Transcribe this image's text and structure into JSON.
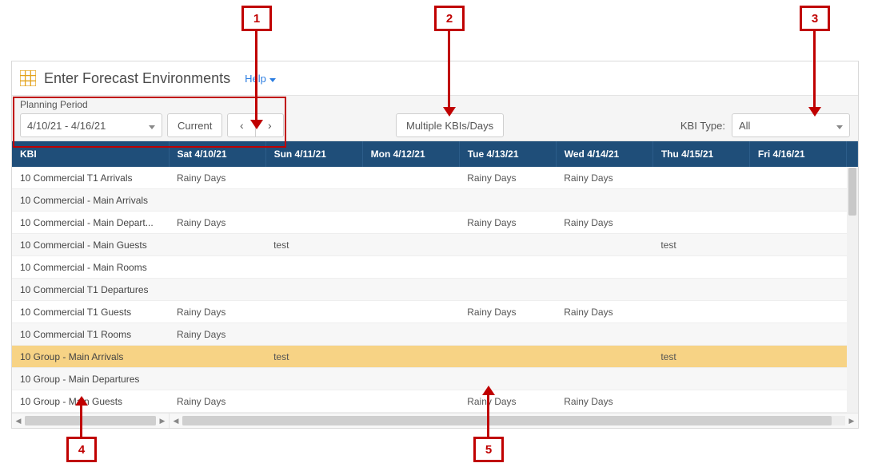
{
  "page_title": "Enter Forecast Environments",
  "help_label": "Help",
  "planning": {
    "label": "Planning Period",
    "range": "4/10/21 - 4/16/21",
    "current_label": "Current"
  },
  "multi_btn": "Multiple KBIs/Days",
  "kbi_type": {
    "label": "KBI Type:",
    "value": "All"
  },
  "columns": [
    "KBI",
    "Sat 4/10/21",
    "Sun 4/11/21",
    "Mon 4/12/21",
    "Tue 4/13/21",
    "Wed 4/14/21",
    "Thu 4/15/21",
    "Fri 4/16/21"
  ],
  "rows": [
    {
      "kbi": "10 Commercial T1 Arrivals",
      "cells": [
        "Rainy Days",
        "",
        "",
        "Rainy Days",
        "Rainy Days",
        "",
        ""
      ]
    },
    {
      "kbi": "10 Commercial - Main Arrivals",
      "cells": [
        "",
        "",
        "",
        "",
        "",
        "",
        ""
      ]
    },
    {
      "kbi": "10 Commercial - Main Depart...",
      "cells": [
        "Rainy Days",
        "",
        "",
        "Rainy Days",
        "Rainy Days",
        "",
        ""
      ]
    },
    {
      "kbi": "10 Commercial - Main Guests",
      "cells": [
        "",
        "test",
        "",
        "",
        "",
        "test",
        ""
      ]
    },
    {
      "kbi": "10 Commercial - Main Rooms",
      "cells": [
        "",
        "",
        "",
        "",
        "",
        "",
        ""
      ]
    },
    {
      "kbi": "10 Commercial T1 Departures",
      "cells": [
        "",
        "",
        "",
        "",
        "",
        "",
        ""
      ]
    },
    {
      "kbi": "10 Commercial T1 Guests",
      "cells": [
        "Rainy Days",
        "",
        "",
        "Rainy Days",
        "Rainy Days",
        "",
        ""
      ]
    },
    {
      "kbi": "10 Commercial T1 Rooms",
      "cells": [
        "Rainy Days",
        "",
        "",
        "",
        "",
        "",
        ""
      ]
    },
    {
      "kbi": "10 Group - Main Arrivals",
      "cells": [
        "",
        "test",
        "",
        "",
        "",
        "test",
        ""
      ],
      "highlight": true
    },
    {
      "kbi": "10 Group - Main Departures",
      "cells": [
        "",
        "",
        "",
        "",
        "",
        "",
        ""
      ]
    },
    {
      "kbi": "10 Group - Main Guests",
      "cells": [
        "Rainy Days",
        "",
        "",
        "Rainy Days",
        "Rainy Days",
        "",
        ""
      ]
    }
  ],
  "callouts": {
    "1": "1",
    "2": "2",
    "3": "3",
    "4": "4",
    "5": "5"
  }
}
